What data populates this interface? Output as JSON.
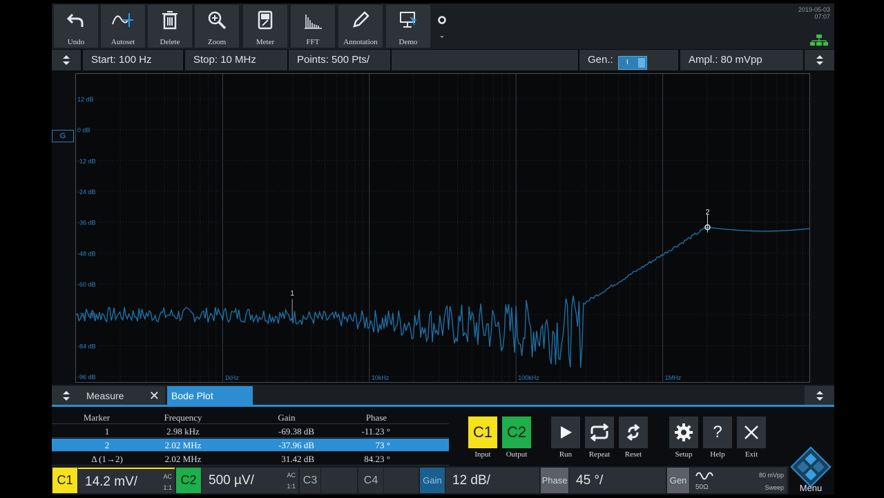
{
  "toolbar": {
    "undo": "Undo",
    "autoset": "Autoset",
    "delete": "Delete",
    "zoom": "Zoom",
    "meter": "Meter",
    "fft": "FFT",
    "annotation": "Annotation",
    "demo": "Demo",
    "date": "2019-05-03",
    "time": "07:07"
  },
  "settings": {
    "start": "Start: 100 Hz",
    "stop": "Stop: 10 MHz",
    "points": "Points: 500 Pts/",
    "gen": "Gen.:",
    "gen_state_mark": "I",
    "ampl": "Ampl.: 80 mVpp"
  },
  "plot": {
    "y_ticks": [
      "12 dB",
      "0 dB",
      "-12 dB",
      "-24 dB",
      "-36 dB",
      "-48 dB",
      "-60 dB",
      "-72 dB",
      "-84 dB",
      "-96 dB"
    ],
    "x_ticks": [
      "1kHz",
      "10kHz",
      "100kHz",
      "1MHz"
    ],
    "g_marker": "G",
    "marker1_label": "1",
    "marker2_label": "2",
    "trace_color": "#1f6fa3"
  },
  "panel": {
    "measure_tab": "Measure",
    "bode_tab": "Bode Plot"
  },
  "table": {
    "headers": [
      "Marker",
      "Frequency",
      "Gain",
      "Phase"
    ],
    "rows": [
      {
        "marker": "1",
        "frequency": "2.98 kHz",
        "gain": "-69.38 dB",
        "phase": "-11.23 °"
      },
      {
        "marker": "2",
        "frequency": "2.02 MHz",
        "gain": "-37.96 dB",
        "phase": "73 °"
      },
      {
        "marker": "Δ (1→2)",
        "frequency": "2.02 MHz",
        "gain": "31.42 dB",
        "phase": "84.23 °"
      }
    ]
  },
  "controls": {
    "c1": "C1",
    "c2": "C2",
    "input": "Input",
    "output": "Output",
    "run": "Run",
    "repeat": "Repeat",
    "reset": "Reset",
    "setup": "Setup",
    "help": "Help",
    "exit": "Exit"
  },
  "status": {
    "c1_tag": "C1",
    "c1_value": "14.2 mV/",
    "c1_coupling": "AC",
    "c1_probe": "1:1",
    "c2_tag": "C2",
    "c2_value": "500 µV/",
    "c2_coupling": "AC",
    "c2_probe": "1:1",
    "c3_tag": "C3",
    "c4_tag": "C4",
    "gain_tag": "Gain",
    "gain_value": "12 dB/",
    "phase_tag": "Phase",
    "phase_value": "45 °/",
    "gen_tag": "Gen",
    "gen_impedance": "50Ω",
    "gen_ampl": "80 mVpp",
    "gen_mode": "Sweep",
    "menu": "Menu"
  },
  "colors": {
    "c1": "#f5e11c",
    "c2": "#1fae4c",
    "accent": "#2c8ed0"
  }
}
